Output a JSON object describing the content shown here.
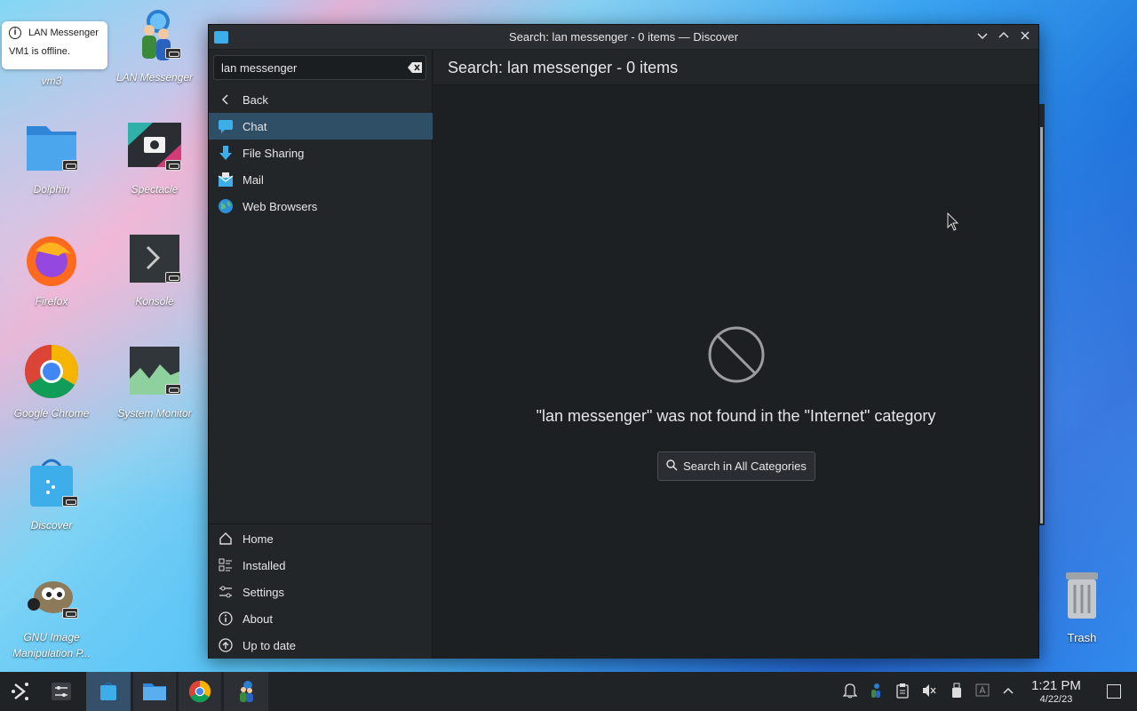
{
  "desktop": {
    "icons": [
      {
        "label": "vm3"
      },
      {
        "label": "LAN Messenger"
      },
      {
        "label": "Dolphin"
      },
      {
        "label": "Spectacle"
      },
      {
        "label": "Firefox"
      },
      {
        "label": "Konsole"
      },
      {
        "label": "Google Chrome"
      },
      {
        "label": "System Monitor"
      },
      {
        "label": "Discover"
      },
      {
        "label": "GNU Image Manipulation P..."
      }
    ],
    "trash_label": "Trash"
  },
  "notification": {
    "title": "LAN Messenger",
    "body": "VM1 is offline."
  },
  "window": {
    "title": "Search: lan messenger - 0 items — Discover",
    "search": {
      "value": "lan messenger"
    },
    "nav_top": [
      {
        "label": "Back",
        "icon": "back-arrow-icon"
      },
      {
        "label": "Chat",
        "icon": "chat-icon",
        "selected": true
      },
      {
        "label": "File Sharing",
        "icon": "file-sharing-icon"
      },
      {
        "label": "Mail",
        "icon": "mail-icon"
      },
      {
        "label": "Web Browsers",
        "icon": "globe-icon"
      }
    ],
    "nav_bottom": [
      {
        "label": "Home",
        "icon": "home-icon"
      },
      {
        "label": "Installed",
        "icon": "installed-icon"
      },
      {
        "label": "Settings",
        "icon": "settings-icon"
      },
      {
        "label": "About",
        "icon": "info-icon"
      },
      {
        "label": "Up to date",
        "icon": "update-icon"
      }
    ],
    "header": "Search: lan messenger - 0 items",
    "empty_message": "\"lan messenger\" was not found in the \"Internet\" category",
    "search_all_label": "Search in All Categories"
  },
  "taskbar": {
    "clock_time": "1:21 PM",
    "clock_date": "4/22/23"
  },
  "colors": {
    "accent": "#3daee9",
    "selection": "#2f4f66",
    "window_bg": "#202326"
  }
}
